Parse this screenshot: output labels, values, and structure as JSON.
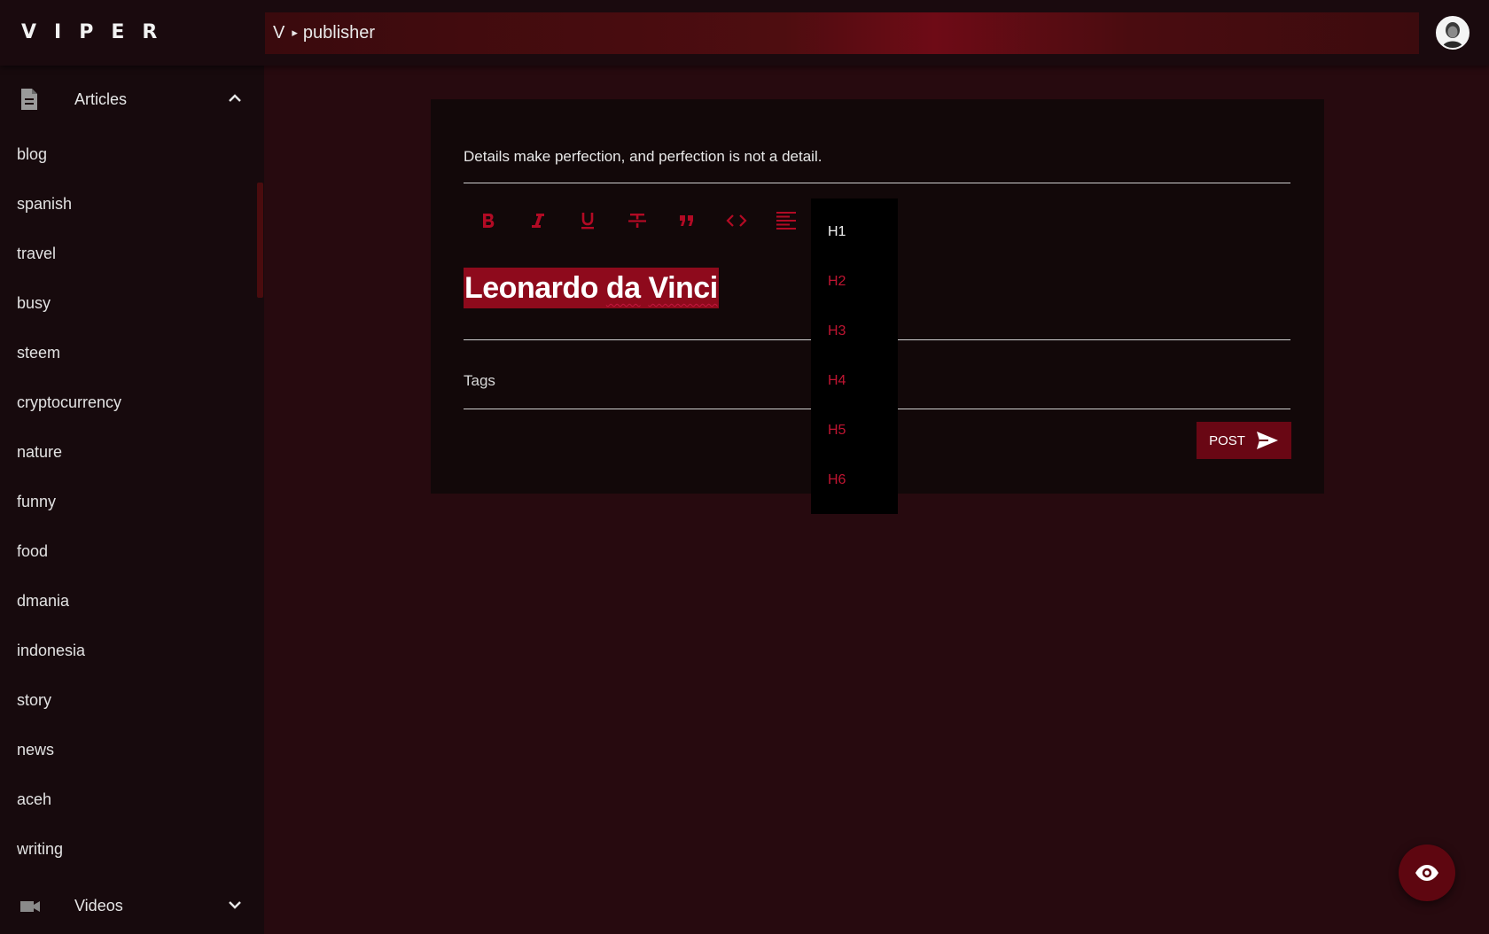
{
  "app": {
    "logo": "VIPER"
  },
  "breadcrumb": {
    "root": "V",
    "separator": "▸",
    "current": "publisher"
  },
  "user": {
    "avatar": "user-avatar"
  },
  "sidebar": {
    "articles_label": "Articles",
    "videos_label": "Videos",
    "categories": [
      "blog",
      "spanish",
      "travel",
      "busy",
      "steem",
      "cryptocurrency",
      "nature",
      "funny",
      "food",
      "dmania",
      "indonesia",
      "story",
      "news",
      "aceh",
      "writing"
    ]
  },
  "editor": {
    "quote": "Details make perfection, and perfection is not a detail.",
    "title_word1": "Leonardo",
    "title_word2": "da",
    "title_word3": "Vinci",
    "tags_placeholder": "Tags",
    "post_label": "POST",
    "toolbar_icons": [
      "bold-icon",
      "italic-icon",
      "underline-icon",
      "strikethrough-icon",
      "quote-icon",
      "code-icon",
      "align-left-icon"
    ]
  },
  "heading_menu": {
    "items": [
      "H1",
      "H2",
      "H3",
      "H4",
      "H5",
      "H6"
    ],
    "active": "H1"
  },
  "colors": {
    "accent": "#b20a24",
    "title_highlight": "#8e0a1c",
    "background": "#270a0f",
    "sidebar": "#170a0d"
  },
  "fab": {
    "icon": "eye-icon"
  }
}
